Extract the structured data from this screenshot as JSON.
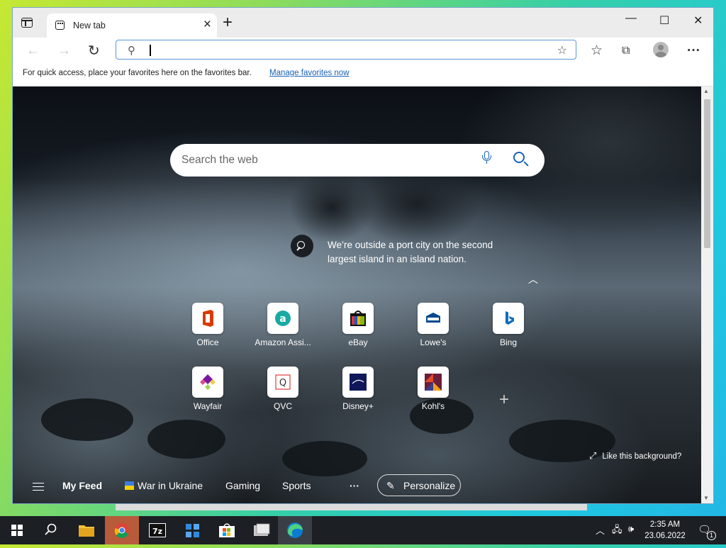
{
  "browser": {
    "tab": {
      "title": "New tab"
    },
    "window_controls": {
      "minimize": "—",
      "maximize": "☐",
      "close": "✕"
    },
    "address": {
      "placeholder": "",
      "value": ""
    },
    "favbar": {
      "message": "For quick access, place your favorites here on the favorites bar.",
      "link": "Manage favorites now"
    }
  },
  "newtab": {
    "search_placeholder": "Search the web",
    "background_info": "We’re outside a port city on the second largest island in an island nation.",
    "tiles_row1": [
      {
        "label": "Office",
        "icon": "office-icon"
      },
      {
        "label": "Amazon Assi...",
        "icon": "amazon-assistant-icon"
      },
      {
        "label": "eBay",
        "icon": "ebay-icon"
      },
      {
        "label": "Lowe's",
        "icon": "lowes-icon"
      },
      {
        "label": "Bing",
        "icon": "bing-icon"
      }
    ],
    "tiles_row2": [
      {
        "label": "Wayfair",
        "icon": "wayfair-icon"
      },
      {
        "label": "QVC",
        "icon": "qvc-icon"
      },
      {
        "label": "Disney+",
        "icon": "disney-plus-icon"
      },
      {
        "label": "Kohl's",
        "icon": "kohls-icon"
      }
    ],
    "like_background": "Like this background?",
    "feed": {
      "my_feed": "My Feed",
      "war": "War in Ukraine",
      "gaming": "Gaming",
      "sports": "Sports",
      "more": "···",
      "personalize": "Personalize"
    }
  },
  "taskbar": {
    "clock_time": "2:35 AM",
    "clock_date": "23.06.2022",
    "notification_count": "1",
    "apps": [
      "file-explorer",
      "chrome",
      "7zip",
      "network-app",
      "store",
      "app",
      "edge"
    ]
  }
}
